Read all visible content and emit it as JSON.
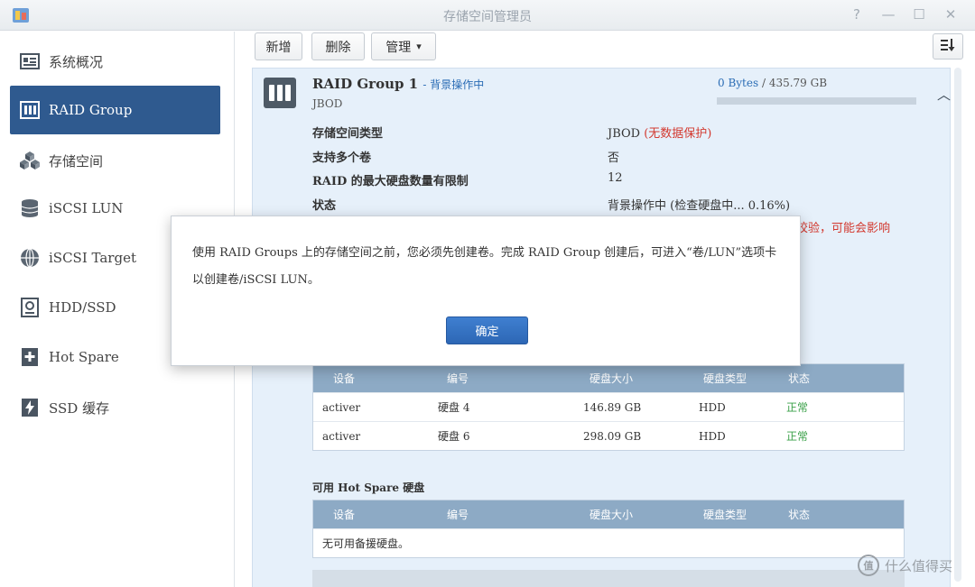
{
  "window": {
    "title": "存储空间管理员"
  },
  "window_controls": {
    "help": "?",
    "minimize": "—",
    "maximize": "☐",
    "close": "✕"
  },
  "sidebar": {
    "items": [
      {
        "label": "系统概况",
        "icon": "overview-icon"
      },
      {
        "label": "RAID Group",
        "icon": "raid-group-icon",
        "active": true
      },
      {
        "label": "存储空间",
        "icon": "storage-cubes-icon"
      },
      {
        "label": "iSCSI LUN",
        "icon": "database-icon"
      },
      {
        "label": "iSCSI Target",
        "icon": "globe-icon"
      },
      {
        "label": "HDD/SSD",
        "icon": "hdd-icon"
      },
      {
        "label": "Hot Spare",
        "icon": "plus-box-icon"
      },
      {
        "label": "SSD 缓存",
        "icon": "lightning-icon"
      }
    ]
  },
  "toolbar": {
    "create_label": "新增",
    "delete_label": "删除",
    "manage_label": "管理",
    "manage_arrow": "▾"
  },
  "raid_group": {
    "name": "RAID Group 1",
    "status_suffix": "- 背景操作中",
    "type": "JBOD",
    "capacity_used": "0 Bytes",
    "capacity_total": "/ 435.79 GB",
    "capacity_fraction": 0.0,
    "info": [
      {
        "label": "存储空间类型",
        "value": "JBOD",
        "warn": "(无数据保护)"
      },
      {
        "label": "支持多个卷",
        "value": "否"
      },
      {
        "label": "RAID 的最大硬盘数量有限制",
        "value": "12"
      },
      {
        "label": "状态",
        "value": "背景操作中 (检查硬盘中... 0.16%)"
      }
    ],
    "warning_overflow": "校验，可能会影响"
  },
  "disk_table": {
    "columns": [
      "设备",
      "编号",
      "硬盘大小",
      "硬盘类型",
      "状态"
    ],
    "rows": [
      [
        "activer",
        "硬盘 4",
        "146.89 GB",
        "HDD",
        "正常"
      ],
      [
        "activer",
        "硬盘 6",
        "298.09 GB",
        "HDD",
        "正常"
      ]
    ]
  },
  "hot_spare": {
    "label": "可用 Hot Spare 硬盘",
    "columns": [
      "设备",
      "编号",
      "硬盘大小",
      "硬盘类型",
      "状态"
    ],
    "empty_text": "无可用备援硬盘。"
  },
  "dialog": {
    "message": "使用 RAID Groups 上的存储空间之前，您必须先创建卷。完成 RAID Group 创建后，可进入“卷/LUN”选项卡以创建卷/iSCSI LUN。",
    "ok_label": "确定"
  },
  "watermark": {
    "badge": "值",
    "text": "什么值得买"
  },
  "colors": {
    "accent": "#2f5a8f",
    "link": "#2a6cb5",
    "warning": "#d3392f",
    "ok": "#3aa048",
    "table_header": "#8daac5"
  }
}
